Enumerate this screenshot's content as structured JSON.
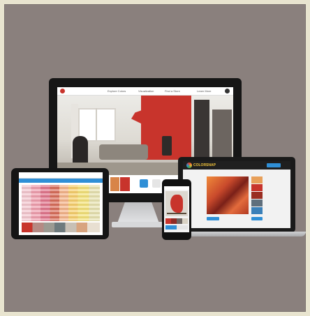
{
  "monitor": {
    "nav_items": [
      "Explore Colors",
      "Visualization",
      "Find a Store",
      "Learn More"
    ]
  },
  "tablet": {
    "tabs": [
      "",
      "",
      "",
      ""
    ]
  },
  "laptop": {
    "logo_text": "COLORSNAP",
    "button_label": ""
  },
  "colors": {
    "background": "#e8e4cf",
    "panel": "#8a807d",
    "accent_red": "#c8342c",
    "accent_blue": "#2f8fd6"
  }
}
